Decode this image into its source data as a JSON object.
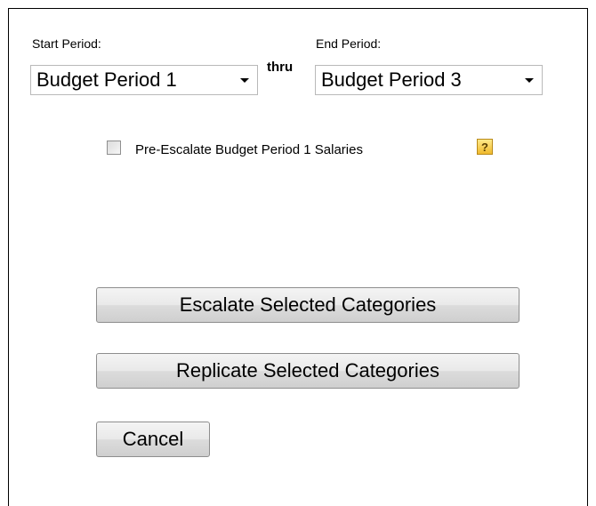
{
  "period": {
    "start_label": "Start Period:",
    "start_value": "Budget Period 1",
    "thru_label": "thru",
    "end_label": "End Period:",
    "end_value": "Budget Period 3"
  },
  "pre_escalate": {
    "label": "Pre-Escalate Budget Period 1 Salaries",
    "checked": false,
    "help_symbol": "?",
    "help_icon": "help-question-icon"
  },
  "actions": {
    "escalate_label": "Escalate Selected Categories",
    "replicate_label": "Replicate Selected Categories",
    "cancel_label": "Cancel"
  }
}
